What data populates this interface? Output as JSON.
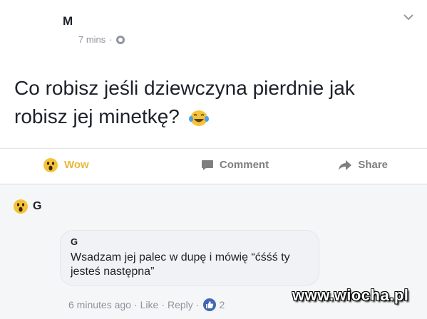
{
  "post": {
    "author": "M",
    "time": "7 mins",
    "separator": "·",
    "text": "Co robisz jeśli dziewczyna pierdnie jak robisz jej minetkę?",
    "actions": {
      "wow": "Wow",
      "comment": "Comment",
      "share": "Share"
    }
  },
  "reaction": {
    "reactor": "G"
  },
  "comment": {
    "author": "G",
    "text": "Wsadzam jej palec w dupę i mówię “ćśśś ty jesteś następna”",
    "time": "6 minutes ago",
    "like": "Like",
    "reply": "Reply",
    "dot": "·",
    "likes": "2"
  },
  "watermark": "www.wiocha.pl",
  "colors": {
    "wow": "#e9b83a",
    "like": "#4267b2",
    "muted": "#90949c"
  }
}
